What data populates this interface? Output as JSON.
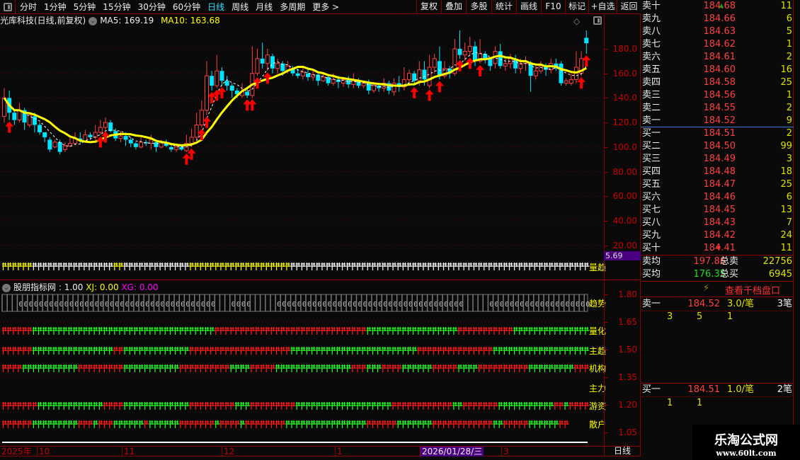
{
  "toolbar": {
    "periods": [
      "分时",
      "1分钟",
      "5分钟",
      "15分钟",
      "30分钟",
      "60分钟",
      "日线",
      "周线",
      "月线",
      "多周期",
      "更多 >"
    ],
    "active_period": "日线",
    "buttons": [
      "复权",
      "叠加",
      "多股",
      "统计",
      "画线",
      "F10",
      "标记",
      "+自选",
      "返回"
    ]
  },
  "title": {
    "stock": "光库科技(日线,前复权)",
    "ma5": "MA5: 169.19",
    "ma10": "MA10: 163.68"
  },
  "colors": {
    "up": "#ff4040",
    "down": "#00e5ff",
    "ma10": "#ffff00",
    "ma5": "#ffffff",
    "grid": "#7a0000",
    "signal": "#ff0000",
    "green": "#22ff22"
  },
  "main_axis": {
    "ticks": [
      "180.0",
      "160.0",
      "140.0",
      "120.0",
      "100.0",
      "80.00",
      "60.00",
      "40.00",
      "20.00"
    ],
    "tick_values": [
      180,
      160,
      140,
      120,
      100,
      80,
      60,
      40,
      20
    ],
    "marker": "5.69"
  },
  "chart_data": {
    "type": "candlestick",
    "title": "光库科技(日线,前复权)",
    "ylim": [
      5.69,
      195
    ],
    "ohlc": [
      [
        125,
        148,
        120,
        140
      ],
      [
        140,
        146,
        122,
        128
      ],
      [
        128,
        130,
        118,
        122
      ],
      [
        122,
        136,
        120,
        130
      ],
      [
        130,
        132,
        114,
        120
      ],
      [
        118,
        128,
        116,
        126
      ],
      [
        125,
        128,
        112,
        118
      ],
      [
        118,
        120,
        110,
        112
      ],
      [
        112,
        112,
        104,
        108
      ],
      [
        106,
        108,
        96,
        98
      ],
      [
        100,
        106,
        99,
        104
      ],
      [
        104,
        106,
        94,
        96
      ],
      [
        98,
        104,
        96,
        101
      ],
      [
        101,
        108,
        100,
        103
      ],
      [
        103,
        112,
        102,
        107
      ],
      [
        107,
        112,
        103,
        105
      ],
      [
        105,
        114,
        104,
        110
      ],
      [
        110,
        112,
        106,
        108
      ],
      [
        108,
        118,
        106,
        112
      ],
      [
        112,
        122,
        110,
        116
      ],
      [
        116,
        124,
        114,
        120
      ],
      [
        120,
        122,
        112,
        113
      ],
      [
        113,
        115,
        105,
        107
      ],
      [
        107,
        113,
        104,
        109
      ],
      [
        109,
        112,
        101,
        106
      ],
      [
        106,
        108,
        100,
        103
      ],
      [
        103,
        104,
        98,
        100
      ],
      [
        100,
        108,
        99,
        104
      ],
      [
        104,
        106,
        101,
        103
      ],
      [
        103,
        110,
        98,
        106
      ],
      [
        104,
        106,
        96,
        100
      ],
      [
        100,
        106,
        99,
        104
      ],
      [
        104,
        106,
        100,
        101
      ],
      [
        100,
        102,
        96,
        98
      ],
      [
        98,
        103,
        96,
        100
      ],
      [
        100,
        101,
        97,
        98
      ],
      [
        97,
        110,
        96,
        103
      ],
      [
        103,
        115,
        100,
        108
      ],
      [
        108,
        128,
        106,
        118
      ],
      [
        118,
        138,
        116,
        130
      ],
      [
        130,
        170,
        126,
        158
      ],
      [
        158,
        162,
        146,
        150
      ],
      [
        150,
        175,
        148,
        162
      ],
      [
        162,
        165,
        150,
        154
      ],
      [
        154,
        158,
        146,
        150
      ],
      [
        150,
        152,
        140,
        146
      ],
      [
        146,
        148,
        140,
        143
      ],
      [
        142,
        152,
        140,
        145
      ],
      [
        145,
        149,
        140,
        142
      ],
      [
        142,
        182,
        140,
        160
      ],
      [
        160,
        180,
        158,
        172
      ],
      [
        172,
        185,
        164,
        168
      ],
      [
        168,
        180,
        162,
        175
      ],
      [
        174,
        176,
        160,
        164
      ],
      [
        164,
        172,
        160,
        168
      ],
      [
        168,
        170,
        158,
        162
      ],
      [
        162,
        170,
        160,
        166
      ],
      [
        164,
        166,
        158,
        160
      ],
      [
        160,
        164,
        156,
        158
      ],
      [
        158,
        165,
        155,
        161
      ],
      [
        160,
        163,
        154,
        157
      ],
      [
        157,
        162,
        154,
        159
      ],
      [
        159,
        160,
        150,
        154
      ],
      [
        154,
        160,
        153,
        157
      ],
      [
        157,
        158,
        150,
        152
      ],
      [
        152,
        160,
        150,
        155
      ],
      [
        155,
        158,
        148,
        153
      ],
      [
        152,
        157,
        149,
        155
      ],
      [
        155,
        158,
        148,
        151
      ],
      [
        151,
        160,
        148,
        154
      ],
      [
        154,
        156,
        148,
        150
      ],
      [
        150,
        154,
        148,
        152
      ],
      [
        152,
        155,
        143,
        146
      ],
      [
        146,
        153,
        144,
        150
      ],
      [
        150,
        152,
        145,
        148
      ],
      [
        148,
        156,
        145,
        152
      ],
      [
        152,
        154,
        143,
        146
      ],
      [
        145,
        156,
        142,
        152
      ],
      [
        152,
        158,
        145,
        149
      ],
      [
        149,
        165,
        146,
        155
      ],
      [
        155,
        163,
        150,
        160
      ],
      [
        160,
        162,
        150,
        154
      ],
      [
        154,
        170,
        150,
        163
      ],
      [
        163,
        170,
        150,
        155
      ],
      [
        150,
        175,
        148,
        165
      ],
      [
        165,
        176,
        160,
        172
      ],
      [
        170,
        182,
        155,
        158
      ],
      [
        158,
        170,
        156,
        164
      ],
      [
        164,
        166,
        156,
        160
      ],
      [
        160,
        188,
        158,
        180
      ],
      [
        180,
        195,
        172,
        175
      ],
      [
        175,
        185,
        170,
        178
      ],
      [
        178,
        190,
        174,
        182
      ],
      [
        182,
        186,
        166,
        170
      ],
      [
        170,
        188,
        168,
        176
      ],
      [
        176,
        178,
        168,
        172
      ],
      [
        172,
        172,
        162,
        166
      ],
      [
        168,
        182,
        164,
        178
      ],
      [
        178,
        184,
        164,
        166
      ],
      [
        166,
        172,
        162,
        168
      ],
      [
        168,
        176,
        164,
        172
      ],
      [
        172,
        175,
        160,
        164
      ],
      [
        164,
        172,
        160,
        168
      ],
      [
        168,
        174,
        162,
        170
      ],
      [
        168,
        170,
        145,
        158
      ],
      [
        158,
        166,
        155,
        162
      ],
      [
        162,
        170,
        160,
        166
      ],
      [
        166,
        168,
        158,
        163
      ],
      [
        163,
        172,
        160,
        168
      ],
      [
        168,
        172,
        162,
        164
      ],
      [
        168,
        170,
        150,
        152
      ],
      [
        152,
        156,
        150,
        154
      ],
      [
        152,
        160,
        150,
        155
      ],
      [
        155,
        178,
        152,
        165
      ],
      [
        160,
        178,
        158,
        172
      ],
      [
        189,
        195,
        176,
        184.52
      ]
    ],
    "signals": [
      1,
      19,
      20,
      36,
      37,
      39,
      40,
      41,
      42,
      43,
      48,
      49,
      50,
      52,
      81,
      84,
      86,
      90,
      92,
      94,
      114,
      115
    ],
    "ma5_last": 169.19,
    "ma10_last": 163.68
  },
  "volume_strip": {
    "label": "量趋",
    "segments": [
      [
        "y",
        6
      ],
      [
        "w",
        16
      ],
      [
        "y",
        2
      ],
      [
        "w",
        13
      ],
      [
        "y",
        20
      ],
      [
        "w",
        59
      ]
    ]
  },
  "indicator": {
    "name": "股朋指标网",
    "value": ": 1.00",
    "xj": "XJ: 0.00",
    "xg": "XG: 0.00",
    "axis": [
      "1.80",
      "1.65",
      "1.50",
      "1.35",
      "1.20",
      "1.05"
    ],
    "axis_values": [
      1.8,
      1.65,
      1.5,
      1.35,
      1.2,
      1.05
    ],
    "trend": {
      "label": "趋势",
      "cell_text": "0",
      "segments": [
        [
          0,
          3
        ],
        [
          1,
          39
        ],
        [
          0,
          3
        ],
        [
          1,
          4
        ],
        [
          0,
          5
        ],
        [
          1,
          37
        ],
        [
          0,
          5
        ],
        [
          1,
          20
        ]
      ]
    },
    "rows": [
      {
        "label": "量化",
        "segments": [
          [
            "r",
            6
          ],
          [
            "g",
            36
          ],
          [
            "r",
            30
          ],
          [
            "g",
            18
          ],
          [
            "r",
            11
          ],
          [
            "g",
            15
          ]
        ]
      },
      {
        "label": "主趋",
        "segments": [
          [
            "r",
            6
          ],
          [
            "g",
            16
          ],
          [
            "r",
            2
          ],
          [
            "g",
            13
          ],
          [
            "r",
            20
          ],
          [
            "g",
            25
          ],
          [
            "r",
            15
          ],
          [
            "g",
            19
          ]
        ]
      },
      {
        "label": "机构",
        "segments": [
          [
            "r",
            4
          ],
          [
            "g",
            11
          ],
          [
            "r",
            9
          ],
          [
            "g",
            11
          ],
          [
            "r",
            10
          ],
          [
            "g",
            4
          ],
          [
            "r",
            5
          ],
          [
            "g",
            15
          ],
          [
            "r",
            3
          ],
          [
            "g",
            3
          ],
          [
            "r",
            4
          ],
          [
            "g",
            6
          ],
          [
            "r",
            5
          ],
          [
            "g",
            4
          ],
          [
            "r",
            10
          ],
          [
            "g",
            9
          ],
          [
            "r",
            3
          ]
        ]
      },
      {
        "label": "主力",
        "segments": []
      },
      {
        "label": "游资",
        "segments": [
          [
            "r",
            7
          ],
          [
            "g",
            13
          ],
          [
            "r",
            4
          ],
          [
            "g",
            13
          ],
          [
            "r",
            9
          ],
          [
            "g",
            3
          ],
          [
            "r",
            9
          ],
          [
            "g",
            19
          ],
          [
            "r",
            12
          ],
          [
            "g",
            2
          ],
          [
            "r",
            7
          ],
          [
            "g",
            11
          ],
          [
            "r",
            2
          ],
          [
            "g",
            1
          ],
          [
            "r",
            4
          ]
        ]
      },
      {
        "label": "散户",
        "segments": [
          [
            "r",
            6
          ],
          [
            "g",
            9
          ],
          [
            "r",
            3
          ],
          [
            "g",
            1
          ],
          [
            "r",
            3
          ],
          [
            "g",
            6
          ],
          [
            "r",
            1
          ],
          [
            "g",
            6
          ],
          [
            "r",
            7
          ],
          [
            "g",
            1
          ],
          [
            "r",
            4
          ],
          [
            "g",
            1
          ],
          [
            "r",
            8
          ],
          [
            "g",
            16
          ],
          [
            "r",
            6
          ],
          [
            "g",
            7
          ],
          [
            "r",
            12
          ],
          [
            "g",
            2
          ],
          [
            "r",
            5
          ],
          [
            "g",
            6
          ],
          [
            "r",
            2
          ]
        ]
      }
    ]
  },
  "dates": {
    "year": "2025年",
    "months": [
      "10",
      "11",
      "12",
      "1",
      "3"
    ],
    "cursor": "2026/01/28/三",
    "period": "日线"
  },
  "orderbook": {
    "asks": [
      {
        "label": "卖十",
        "price": "184.68",
        "vol": "11"
      },
      {
        "label": "卖九",
        "price": "184.66",
        "vol": "6"
      },
      {
        "label": "卖八",
        "price": "184.63",
        "vol": "5"
      },
      {
        "label": "卖七",
        "price": "184.62",
        "vol": "1"
      },
      {
        "label": "卖六",
        "price": "184.61",
        "vol": "2"
      },
      {
        "label": "卖五",
        "price": "184.60",
        "vol": "16"
      },
      {
        "label": "卖四",
        "price": "184.58",
        "vol": "25"
      },
      {
        "label": "卖三",
        "price": "184.56",
        "vol": "1"
      },
      {
        "label": "卖二",
        "price": "184.55",
        "vol": "2"
      },
      {
        "label": "卖一",
        "price": "184.52",
        "vol": "9"
      }
    ],
    "bids": [
      {
        "label": "买一",
        "price": "184.51",
        "vol": "2"
      },
      {
        "label": "买二",
        "price": "184.50",
        "vol": "99"
      },
      {
        "label": "买三",
        "price": "184.49",
        "vol": "3"
      },
      {
        "label": "买四",
        "price": "184.48",
        "vol": "18"
      },
      {
        "label": "买五",
        "price": "184.47",
        "vol": "25"
      },
      {
        "label": "买六",
        "price": "184.46",
        "vol": "6"
      },
      {
        "label": "买七",
        "price": "184.45",
        "vol": "13"
      },
      {
        "label": "买八",
        "price": "184.43",
        "vol": "7"
      },
      {
        "label": "买九",
        "price": "184.42",
        "vol": "24"
      },
      {
        "label": "买十",
        "price": "184.41",
        "vol": "11"
      }
    ],
    "avg_sell_label": "卖均",
    "avg_sell": "197.86",
    "total_sell_label": "总卖",
    "total_sell": "22756",
    "avg_buy_label": "买均",
    "avg_buy": "176.35",
    "total_buy_label": "总买",
    "total_buy": "6945",
    "level_link": "查看千档盘口",
    "ask1": {
      "label": "卖一",
      "price": "184.52",
      "per": "3.0/笔",
      "count": "3笔",
      "orders": [
        "3",
        "5",
        "1"
      ]
    },
    "bid1": {
      "label": "买一",
      "price": "184.51",
      "per": "1.0/笔",
      "count": "2笔",
      "orders": [
        "1",
        "1"
      ]
    }
  },
  "watermark": {
    "title": "乐淘公式网",
    "url": "www.60lt.com"
  }
}
